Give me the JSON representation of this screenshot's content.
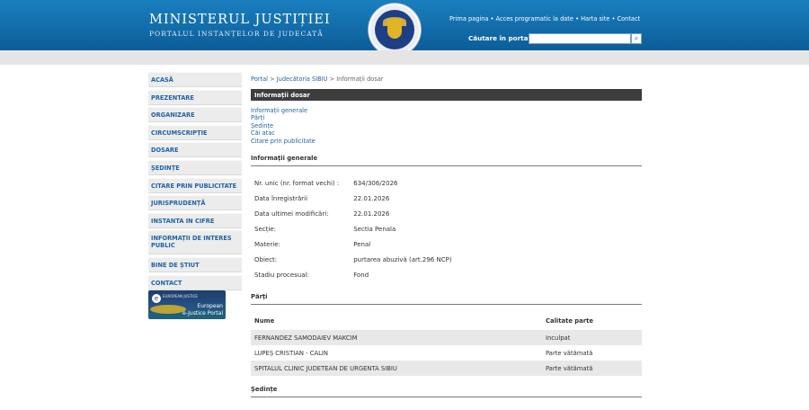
{
  "header": {
    "title": "MINISTERUL JUSTIȚIEI",
    "subtitle": "PORTALUL INSTANȚELOR DE JUDECATĂ",
    "links": [
      "Prima pagina",
      "Acces programatic la date",
      "Harta site",
      "Contact"
    ],
    "search_label": "Căutare în portal",
    "search_value": "",
    "search_icon": "search-icon"
  },
  "sidebar": {
    "items": [
      {
        "label": "ACASĂ"
      },
      {
        "label": "PREZENTARE"
      },
      {
        "label": "ORGANIZARE"
      },
      {
        "label": "CIRCUMSCRIPȚIE"
      },
      {
        "label": "DOSARE"
      },
      {
        "label": "ȘEDINȚE"
      },
      {
        "label": "CITARE PRIN PUBLICITATE"
      },
      {
        "label": "JURISPRUDENȚĂ"
      },
      {
        "label": "INSTANTA IN CIFRE"
      },
      {
        "label": "INFORMAȚII DE INTERES PUBLIC"
      },
      {
        "label": "BINE DE ȘTIUT"
      },
      {
        "label": "CONTACT"
      }
    ],
    "banner": {
      "top_line": "EUROPEAN JUSTICE",
      "line1": "European",
      "line2": "e-Justice Portal"
    }
  },
  "breadcrumb": {
    "items": [
      "Portal",
      "Judecătoria SIBIU",
      "Informații dosar"
    ],
    "separator": ">"
  },
  "section_title": "Informații dosar",
  "tabs": [
    "Informații generale",
    "Părți",
    "Ședințe",
    "Căi atac",
    "Citare prin publicitate"
  ],
  "general": {
    "heading": "Informații generale",
    "rows": [
      {
        "label": "Nr. unic (nr. format vechi) :",
        "value": "634/306/2026"
      },
      {
        "label": "Data înregistrării",
        "value": "22.01.2026"
      },
      {
        "label": "Data ultimei modificări:",
        "value": "22.01.2026"
      },
      {
        "label": "Secție:",
        "value": "Sectia Penala"
      },
      {
        "label": "Materie:",
        "value": "Penal"
      },
      {
        "label": "Obiect:",
        "value": "purtarea abuzivă (art.296 NCP)"
      },
      {
        "label": "Stadiu procesual:",
        "value": "Fond"
      }
    ]
  },
  "parties": {
    "heading": "Părți",
    "columns": [
      "Nume",
      "Calitate parte"
    ],
    "rows": [
      {
        "name": "FERNANDEZ SAMODAIEV MAKCIM",
        "role": "Inculpat"
      },
      {
        "name": "LUPEȘ CRISTIAN - CALIN",
        "role": "Parte vătămată"
      },
      {
        "name": "SPITALUL CLINIC JUDETEAN DE URGENTA SIBIU",
        "role": "Parte vătămată"
      }
    ]
  },
  "hearings": {
    "heading": "Ședințe"
  }
}
